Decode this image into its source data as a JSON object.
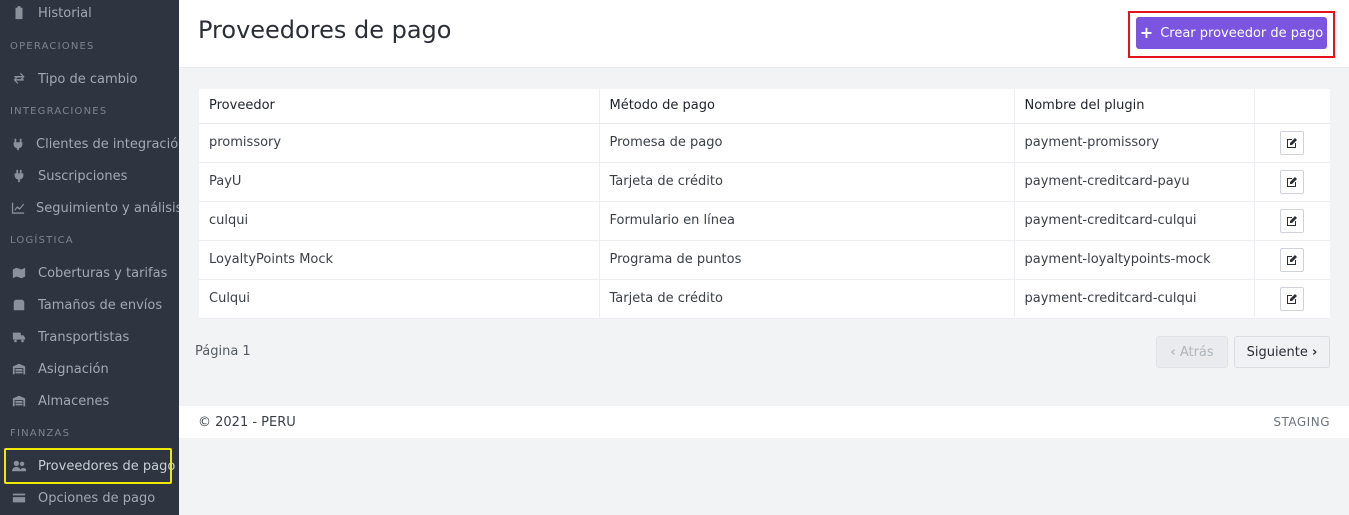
{
  "sidebar": {
    "items": [
      {
        "label": "Historial",
        "icon": "clipboard-icon"
      },
      {
        "label": "Tipo de cambio",
        "icon": "exchange-icon"
      },
      {
        "label": "Clientes de integración",
        "icon": "plug-icon"
      },
      {
        "label": "Suscripciones",
        "icon": "power-plug-icon"
      },
      {
        "label": "Seguimiento y análisis",
        "icon": "chart-line-icon"
      },
      {
        "label": "Coberturas y tarifas",
        "icon": "map-icon"
      },
      {
        "label": "Tamaños de envíos",
        "icon": "box-icon"
      },
      {
        "label": "Transportistas",
        "icon": "truck-icon"
      },
      {
        "label": "Asignación",
        "icon": "warehouse-icon"
      },
      {
        "label": "Almacenes",
        "icon": "warehouse-icon"
      },
      {
        "label": "Proveedores de pago",
        "icon": "users-icon"
      },
      {
        "label": "Opciones de pago",
        "icon": "credit-card-icon"
      }
    ],
    "sections": [
      "OPERACIONES",
      "INTEGRACIONES",
      "LOGÍSTICA",
      "FINANZAS"
    ]
  },
  "header": {
    "title": "Proveedores de pago",
    "create_label": "Crear proveedor de pago"
  },
  "table": {
    "columns": [
      "Proveedor",
      "Método de pago",
      "Nombre del plugin",
      ""
    ],
    "rows": [
      [
        "promissory",
        "Promesa de pago",
        "payment-promissory"
      ],
      [
        "PayU",
        "Tarjeta de crédito",
        "payment-creditcard-payu"
      ],
      [
        "culqui",
        "Formulario en línea",
        "payment-creditcard-culqui"
      ],
      [
        "LoyaltyPoints Mock",
        "Programa de puntos",
        "payment-loyaltypoints-mock"
      ],
      [
        "Culqui",
        "Tarjeta de crédito",
        "payment-creditcard-culqui"
      ]
    ]
  },
  "pagination": {
    "page_label": "Página 1",
    "prev_label": "Atrás",
    "next_label": "Siguiente"
  },
  "footer": {
    "copyright": "© 2021 - PERU",
    "environment": "STAGING"
  },
  "colors": {
    "accent": "#7b55e0",
    "sidebar_bg": "#2f3540",
    "highlight_red": "#e3121b",
    "highlight_yellow": "#f0e800"
  }
}
